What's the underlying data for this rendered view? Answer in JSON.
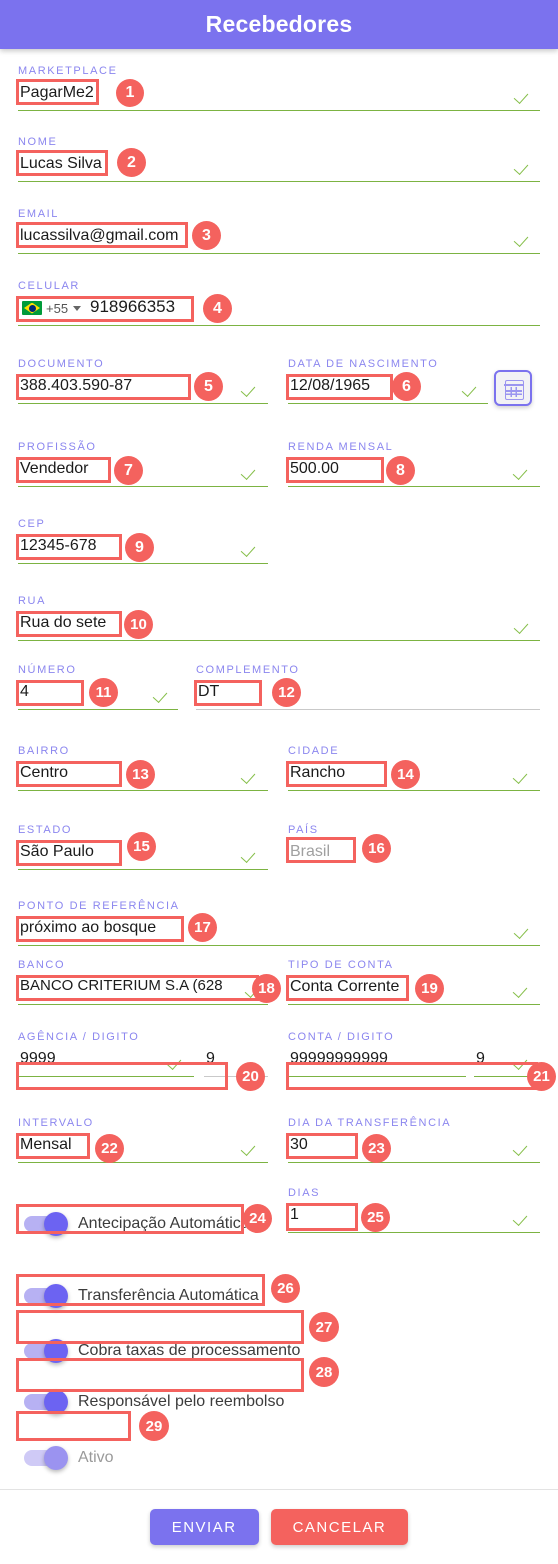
{
  "header": {
    "title": "Recebedores"
  },
  "fields": {
    "marketplace": {
      "label": "MARKETPLACE",
      "value": "PagarMe2",
      "valid": true
    },
    "nome": {
      "label": "NOME",
      "value": "Lucas Silva",
      "valid": true
    },
    "email": {
      "label": "EMAIL",
      "value": "lucassilva@gmail.com",
      "valid": true
    },
    "celular": {
      "label": "CELULAR",
      "country_code": "+55",
      "flag": "br-flag-icon",
      "value": "918966353",
      "valid": false
    },
    "documento": {
      "label": "DOCUMENTO",
      "value": "388.403.590-87",
      "valid": true
    },
    "nascimento": {
      "label": "DATA DE NASCIMENTO",
      "value": "12/08/1965",
      "valid": true,
      "picker_icon": "calendar-icon"
    },
    "profissao": {
      "label": "PROFISSÃO",
      "value": "Vendedor",
      "valid": true
    },
    "renda": {
      "label": "RENDA MENSAL",
      "value": "500.00",
      "valid": true
    },
    "cep": {
      "label": "CEP",
      "value": "12345-678",
      "valid": true
    },
    "rua": {
      "label": "RUA",
      "value": "Rua do sete",
      "valid": true
    },
    "numero": {
      "label": "NÚMERO",
      "value": "4",
      "valid": true
    },
    "complemento": {
      "label": "COMPLEMENTO",
      "value": "DT",
      "valid": false
    },
    "bairro": {
      "label": "BAIRRO",
      "value": "Centro",
      "valid": true
    },
    "cidade": {
      "label": "CIDADE",
      "value": "Rancho",
      "valid": true
    },
    "estado": {
      "label": "ESTADO",
      "value": "São Paulo",
      "valid": true
    },
    "pais": {
      "label": "PAÍS",
      "value": "",
      "placeholder": "Brasil",
      "valid": false
    },
    "referencia": {
      "label": "PONTO DE REFERÊNCIA",
      "value": "próximo ao bosque",
      "valid": true
    },
    "banco": {
      "label": "BANCO",
      "value": "BANCO CRITERIUM S.A (628",
      "valid": true
    },
    "tipo_conta": {
      "label": "TIPO DE CONTA",
      "value": "Conta Corrente",
      "valid": true
    },
    "agencia": {
      "label": "AGÊNCIA / DIGITO",
      "value": "9999",
      "digit": "9",
      "valid": true
    },
    "conta": {
      "label": "CONTA / DIGITO",
      "value": "99999999999",
      "digit": "9",
      "valid": true
    },
    "intervalo": {
      "label": "INTERVALO",
      "value": "Mensal",
      "valid": true
    },
    "dia_transferencia": {
      "label": "DIA DA TRANSFERÊNCIA",
      "value": "30",
      "valid": true
    },
    "dias": {
      "label": "DIAS",
      "value": "1",
      "valid": true
    }
  },
  "toggles": [
    {
      "key": "antecipacao",
      "label": "Antecipação Automática",
      "on": true,
      "enabled": true
    },
    {
      "key": "transferencia",
      "label": "Transferência Automática",
      "on": true,
      "enabled": true
    },
    {
      "key": "taxas",
      "label": "Cobra taxas de processamento",
      "on": true,
      "enabled": true
    },
    {
      "key": "reembolso",
      "label": "Responsável pelo reembolso",
      "on": true,
      "enabled": true
    },
    {
      "key": "ativo",
      "label": "Ativo",
      "on": true,
      "enabled": false
    }
  ],
  "footer": {
    "submit_label": "ENVIAR",
    "cancel_label": "CANCELAR"
  },
  "annotations": {
    "n1": "1",
    "n2": "2",
    "n3": "3",
    "n4": "4",
    "n5": "5",
    "n6": "6",
    "n7": "7",
    "n8": "8",
    "n9": "9",
    "n10": "10",
    "n11": "11",
    "n12": "12",
    "n13": "13",
    "n14": "14",
    "n15": "15",
    "n16": "16",
    "n17": "17",
    "n18": "18",
    "n19": "19",
    "n20": "20",
    "n21": "21",
    "n22": "22",
    "n23": "23",
    "n24": "24",
    "n25": "25",
    "n26": "26",
    "n27": "27",
    "n28": "28",
    "n29": "29"
  },
  "colors": {
    "accent": "#7b72ee",
    "annotation": "#f4625e",
    "valid_line": "#7cb342",
    "label": "#8b86ef"
  }
}
